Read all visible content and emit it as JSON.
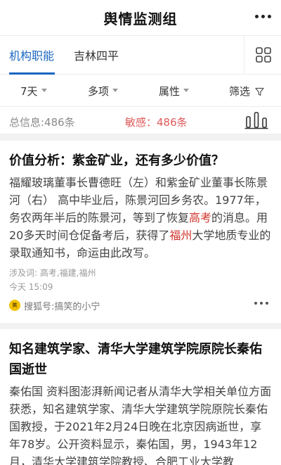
{
  "header": {
    "title": "舆情监测组",
    "more_icon": "more-horizontal-icon"
  },
  "tabs": [
    {
      "label": "机构职能",
      "active": true
    },
    {
      "label": "吉林四平",
      "active": false
    }
  ],
  "grid_icon": "grid-icon",
  "filters": {
    "time": "7天",
    "items": "多项",
    "attribute": "属性",
    "screen": "筛选"
  },
  "stats": {
    "total": "总信息:486条",
    "sensitive": "敏感：486条"
  },
  "articles": [
    {
      "title": "价值分析：紫金矿业，还有多少价值？",
      "body": [
        {
          "text": "福耀玻璃董事长曹德旺（左）和紫金矿业董事长陈景河（右） 高中毕业后，陈景河回乡务农。1977年，务农两年半后的陈景河，等到了恢复",
          "kw": false
        },
        {
          "text": "高考",
          "kw": true
        },
        {
          "text": "的消息。用20多天时间仓促备考后，获得了",
          "kw": false
        },
        {
          "text": "福州",
          "kw": true
        },
        {
          "text": "大学地质专业的录取通知书，命运由此改写。",
          "kw": false
        }
      ],
      "keywords": "涉及词: 高考,福建,福州",
      "time": "今天 15:09",
      "source_badge": "笑",
      "source": "搜狐号:搞笑的小宁"
    },
    {
      "title": "知名建筑学家、清华大学建筑学院原院长秦佑国逝世",
      "body_text": "秦佑国 资料图澎湃新闻记者从清华大学相关单位方面获悉，知名建筑学家、清华大学建筑学院原院长秦佑国教授，于2021年2月24日晚在北京因病逝世，享年78岁。公开资料显示，秦佑国，男，1943年12月，清华大学建筑学院教授、合肥工业大学教"
    }
  ],
  "colors": {
    "accent": "#1a66c2",
    "sensitive": "#e05a5a",
    "keyword": "#d0342c"
  }
}
